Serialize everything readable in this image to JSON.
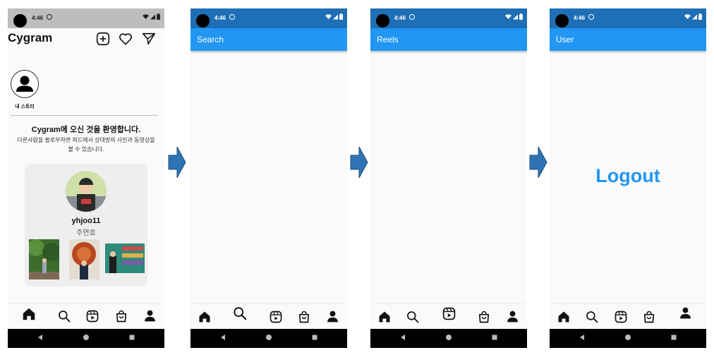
{
  "status": {
    "time": "4:46"
  },
  "home": {
    "brand": "Cygram",
    "story_label": "내 스토리",
    "welcome": "Cygram에 오신 것을 환영합니다.",
    "description_line1": "다른사람을 팔로우하면 피드에서 상대방의 사진과 동영상을",
    "description_line2": "볼 수 있습니다.",
    "suggestion": {
      "username": "yhjoo11",
      "real_name": "주연호"
    }
  },
  "search": {
    "title": "Search"
  },
  "reels": {
    "title": "Reels"
  },
  "user": {
    "title": "User",
    "logout": "Logout"
  },
  "nav_items": [
    "home-icon",
    "search-icon",
    "reels-icon",
    "shop-icon",
    "profile-icon"
  ],
  "colors": {
    "primary": "#2196f3",
    "status_blue": "#1e6fb5",
    "arrow": "#2e74b5"
  }
}
